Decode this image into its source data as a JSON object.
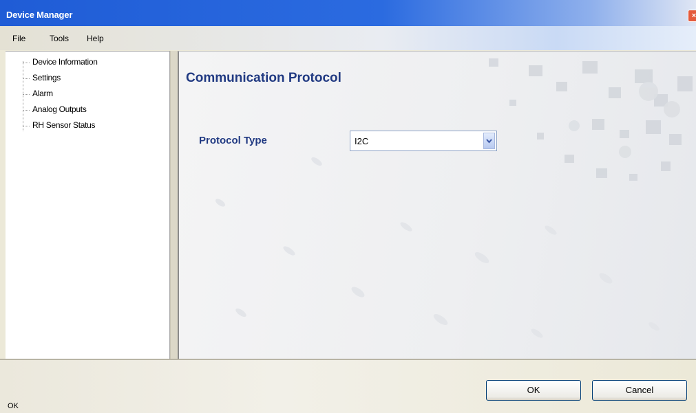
{
  "window": {
    "title": "Device Manager",
    "close_glyph": "×"
  },
  "menu": {
    "items": [
      "File",
      "Tools",
      "Help"
    ]
  },
  "tree": {
    "items": [
      "Device Information",
      "Settings",
      "Alarm",
      "Analog Outputs",
      "RH Sensor Status"
    ]
  },
  "content": {
    "section_title": "Communication Protocol",
    "protocol_label": "Protocol Type",
    "protocol_value": "I2C"
  },
  "buttons": {
    "ok": "OK",
    "cancel": "Cancel"
  },
  "status": {
    "text": "OK"
  },
  "icons": {
    "close": "close-icon",
    "dropdown": "chevron-down-icon"
  },
  "colors": {
    "title_bar": "#2b6be0",
    "heading": "#213a82",
    "window_bg": "#ece9d8"
  }
}
